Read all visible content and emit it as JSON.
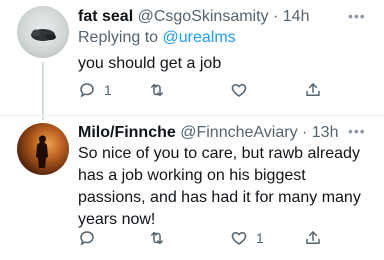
{
  "tweets": [
    {
      "name": "fat seal",
      "handle": "@CsgoSkinsamity",
      "time_sep": " · ",
      "time": "14h",
      "reply_prefix": "Replying to ",
      "reply_mention": "@urealms",
      "text": "you should get a job",
      "reply_count": "1",
      "retweet_count": "",
      "like_count": ""
    },
    {
      "name": "Milo/Finnche",
      "handle": "@FinncheAviary",
      "time_sep": " · ",
      "time": "13h",
      "text": "So nice of you to care, but rawb already has a job working on his biggest passions, and has had it for many many years now!",
      "reply_count": "",
      "retweet_count": "",
      "like_count": "1"
    }
  ],
  "icons": {
    "more": "more-dots-icon",
    "reply": "reply-icon",
    "retweet": "retweet-icon",
    "like": "heart-icon",
    "share": "share-icon"
  },
  "colors": {
    "text": "#0f1419",
    "secondary": "#536471",
    "link": "#1d9bf0",
    "thread_line": "#cfd9de"
  }
}
